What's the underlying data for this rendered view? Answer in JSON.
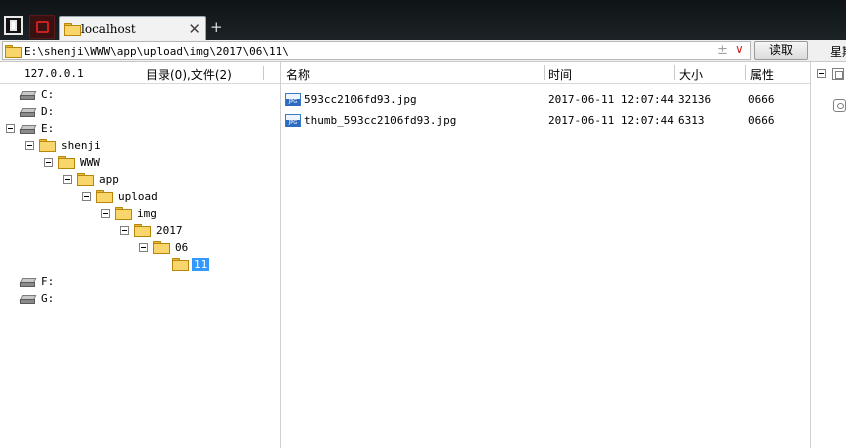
{
  "tab": {
    "title": "localhost",
    "close": "✕",
    "new": "+"
  },
  "address": {
    "path": "E:\\shenji\\WWW\\app\\upload\\img\\2017\\06\\11\\",
    "plus": "±",
    "dropdown": "∨",
    "read_label": "读取",
    "week_label": "星期"
  },
  "left": {
    "host": "127.0.0.1",
    "count": "目录(0),文件(2)",
    "tree": [
      {
        "label": "C:",
        "type": "drive",
        "expandable": false
      },
      {
        "label": "D:",
        "type": "drive",
        "expandable": false
      },
      {
        "label": "E:",
        "type": "drive",
        "expandable": true
      },
      {
        "label": "shenji",
        "type": "folder",
        "expandable": true
      },
      {
        "label": "WWW",
        "type": "folder",
        "expandable": true
      },
      {
        "label": "app",
        "type": "folder",
        "expandable": true
      },
      {
        "label": "upload",
        "type": "folder",
        "expandable": true
      },
      {
        "label": "img",
        "type": "folder",
        "expandable": true
      },
      {
        "label": "2017",
        "type": "folder",
        "expandable": true
      },
      {
        "label": "06",
        "type": "folder",
        "expandable": true
      },
      {
        "label": "11",
        "type": "folder",
        "expandable": false,
        "selected": true
      },
      {
        "label": "F:",
        "type": "drive",
        "expandable": false
      },
      {
        "label": "G:",
        "type": "drive",
        "expandable": false
      }
    ]
  },
  "columns": {
    "name": "名称",
    "time": "时间",
    "size": "大小",
    "attr": "属性"
  },
  "files": [
    {
      "name": "593cc2106fd93.jpg",
      "time": "2017-06-11 12:07:44",
      "size": "32136",
      "attr": "0666"
    },
    {
      "name": "thumb_593cc2106fd93.jpg",
      "time": "2017-06-11 12:07:44",
      "size": "6313",
      "attr": "0666"
    }
  ],
  "colors": {
    "selection": "#3399ff",
    "titlebar": "#141b1e",
    "close_red": "#c92020"
  }
}
